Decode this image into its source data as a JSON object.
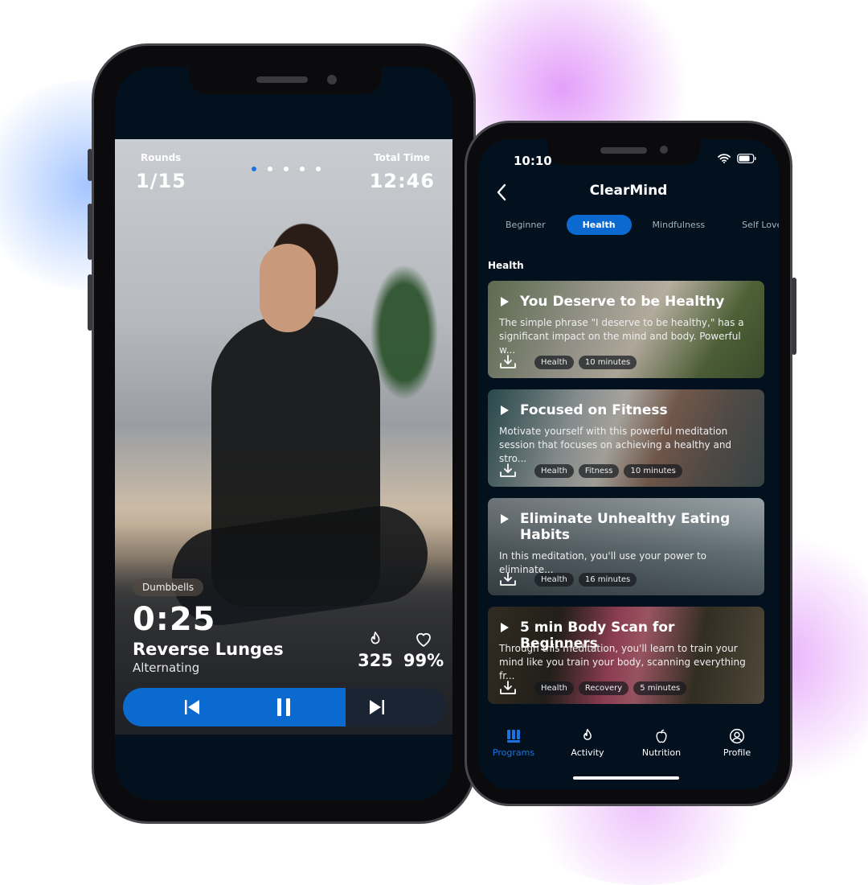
{
  "workout_screen": {
    "rounds_label": "Rounds",
    "rounds_value": "1/15",
    "total_time_label": "Total Time",
    "total_time_value": "12:46",
    "page_dots": {
      "count": 5,
      "active_index": 0
    },
    "equipment_chip": "Dumbbells",
    "timer": "0:25",
    "exercise_name": "Reverse Lunges",
    "exercise_variation": "Alternating",
    "calories": "325",
    "heart_rate": "99%",
    "progress_fraction": 0.69,
    "icons": {
      "calories": "flame-icon",
      "heart": "heart-icon",
      "previous": "skip-previous-icon",
      "pause": "pause-icon",
      "next": "skip-next-icon"
    }
  },
  "meditation_screen": {
    "status_bar": {
      "time": "10:10"
    },
    "app_title": "ClearMind",
    "tabs": [
      {
        "label": "Beginner",
        "active": false
      },
      {
        "label": "Health",
        "active": true
      },
      {
        "label": "Mindfulness",
        "active": false
      },
      {
        "label": "Self Love",
        "active": false
      }
    ],
    "section_title": "Health",
    "cards": [
      {
        "title": "You Deserve to be Healthy",
        "description": "The simple phrase \"I deserve to be healthy,\" has a significant impact on the mind and body. Powerful w...",
        "tags": [
          "Health",
          "10 minutes"
        ]
      },
      {
        "title": "Focused on Fitness",
        "description": "Motivate yourself with this powerful meditation session that focuses on achieving a healthy and stro...",
        "tags": [
          "Health",
          "Fitness",
          "10 minutes"
        ]
      },
      {
        "title": "Eliminate Unhealthy Eating Habits",
        "description": "In this meditation, you'll use your power to eliminate...",
        "tags": [
          "Health",
          "16 minutes"
        ]
      },
      {
        "title": "5 min Body Scan for Beginners",
        "description": "Through this meditation, you'll learn to train your mind like you train your body, scanning everything fr...",
        "tags": [
          "Health",
          "Recovery",
          "5 minutes"
        ]
      }
    ],
    "bottom_nav": [
      {
        "label": "Programs",
        "icon": "programs-icon",
        "active": true
      },
      {
        "label": "Activity",
        "icon": "flame-icon",
        "active": false
      },
      {
        "label": "Nutrition",
        "icon": "apple-icon",
        "active": false
      },
      {
        "label": "Profile",
        "icon": "profile-icon",
        "active": false
      }
    ],
    "colors": {
      "accent": "#0a6ad0",
      "background": "#03111f"
    }
  }
}
